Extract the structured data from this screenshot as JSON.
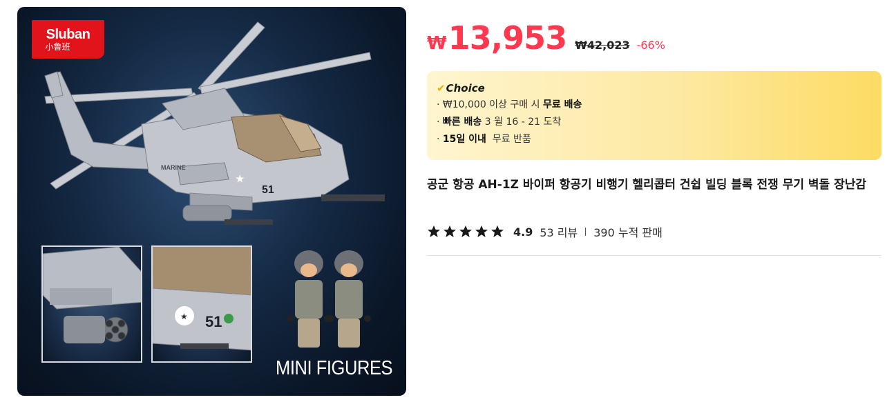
{
  "product_image": {
    "brand_name": "Sluban",
    "brand_subtitle": "小鲁班",
    "marking_text": "MARINE",
    "hull_number": "51",
    "inset_hull_number": "51",
    "inset_label": "MINI FIGURES",
    "colors": {
      "background": "#0e1d33",
      "brand": "#e1131b"
    }
  },
  "price": {
    "currency_symbol": "₩",
    "current": "13,953",
    "original": "₩42,023",
    "discount": "-66%",
    "color": "#fd384f"
  },
  "choice": {
    "badge_icon": "check-icon",
    "label": "Choice",
    "items": [
      {
        "prefix": "· ₩10,000 이상 구매 시 ",
        "bold": "무료 배송",
        "suffix": ""
      },
      {
        "prefix": "· ",
        "bold": "빠른 배송",
        "suffix": " 3 월 16 - 21 도착"
      },
      {
        "prefix": "· ",
        "bold": "15일 이내",
        "suffix": "  무료 반품"
      }
    ]
  },
  "product": {
    "title": "공군 항공 AH-1Z 바이퍼 항공기 비행기 헬리콥터 건쉽 빌딩 블록 전쟁 무기 벽돌 장난감"
  },
  "rating": {
    "stars": 5,
    "star_icon": "star-icon",
    "score": "4.9",
    "reviews": "53 리뷰",
    "sold": "390 누적 판매"
  }
}
